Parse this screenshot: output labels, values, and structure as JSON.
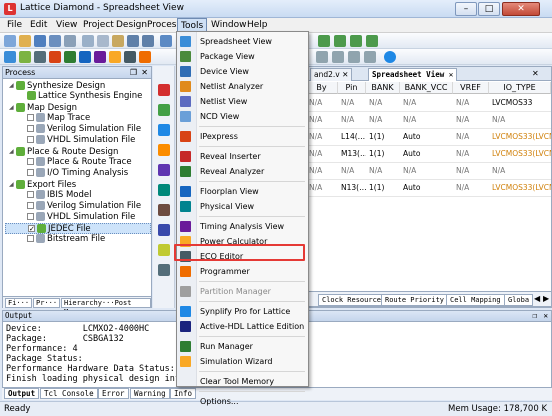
{
  "window": {
    "title": "Lattice Diamond - Spreadsheet View",
    "controls": [
      "–",
      "□",
      "✕"
    ]
  },
  "menubar": [
    "File",
    "Edit",
    "View",
    "Project",
    "Design",
    "Process",
    "Tools",
    "Window",
    "Help"
  ],
  "process_panel": {
    "title": "Process",
    "items": [
      {
        "label": "Synthesize Design",
        "level": 0,
        "kind": "group"
      },
      {
        "label": "Lattice Synthesis Engine",
        "level": 1,
        "kind": "step"
      },
      {
        "label": "Map Design",
        "level": 0,
        "kind": "group"
      },
      {
        "label": "Map Trace",
        "level": 1,
        "kind": "check"
      },
      {
        "label": "Verilog Simulation File",
        "level": 1,
        "kind": "check"
      },
      {
        "label": "VHDL Simulation File",
        "level": 1,
        "kind": "check"
      },
      {
        "label": "Place & Route Design",
        "level": 0,
        "kind": "group"
      },
      {
        "label": "Place & Route Trace",
        "level": 1,
        "kind": "check"
      },
      {
        "label": "I/O Timing Analysis",
        "level": 1,
        "kind": "check"
      },
      {
        "label": "Export Files",
        "level": 0,
        "kind": "group"
      },
      {
        "label": "IBIS Model",
        "level": 1,
        "kind": "check"
      },
      {
        "label": "Verilog Simulation File",
        "level": 1,
        "kind": "check"
      },
      {
        "label": "VHDL Simulation File",
        "level": 1,
        "kind": "check"
      },
      {
        "label": "JEDEC File",
        "level": 1,
        "kind": "checked",
        "selected": true
      },
      {
        "label": "Bitstream File",
        "level": 1,
        "kind": "check"
      }
    ],
    "bottom_tabs": [
      "Fi···",
      "Pr···",
      "Hierarchy···Post M···"
    ]
  },
  "tools_menu": [
    {
      "label": "Spreadsheet View",
      "icon_color": "#3a8dd8"
    },
    {
      "label": "Package View",
      "icon_color": "#4a8a3c"
    },
    {
      "label": "Device View",
      "icon_color": "#2f6db5"
    },
    {
      "label": "Netlist Analyzer",
      "icon_color": "#e08a1c"
    },
    {
      "label": "Netlist View",
      "icon_color": "#5c6bc0"
    },
    {
      "label": "NCD View",
      "icon_color": "#6a9fd8"
    },
    {
      "sep": true
    },
    {
      "label": "IPexpress",
      "icon_color": "#d84315"
    },
    {
      "sep": true
    },
    {
      "label": "Reveal Inserter",
      "icon_color": "#c62828"
    },
    {
      "label": "Reveal Analyzer",
      "icon_color": "#2e7d32"
    },
    {
      "sep": true
    },
    {
      "label": "Floorplan View",
      "icon_color": "#1565c0"
    },
    {
      "label": "Physical View",
      "icon_color": "#00838f"
    },
    {
      "sep": true
    },
    {
      "label": "Timing Analysis View",
      "icon_color": "#6a1b9a"
    },
    {
      "label": "Power Calculator",
      "icon_color": "#f9a825"
    },
    {
      "label": "ECO Editor",
      "icon_color": "#455a64"
    },
    {
      "label": "Programmer",
      "icon_color": "#ef6c00",
      "highlight": true
    },
    {
      "sep": true
    },
    {
      "label": "Partition Manager",
      "icon_color": "#9e9e9e",
      "disabled": true
    },
    {
      "sep": true
    },
    {
      "label": "Synplify Pro for Lattice",
      "icon_color": "#1e88e5"
    },
    {
      "label": "Active-HDL Lattice Edition",
      "icon_color": "#1a237e"
    },
    {
      "sep": true
    },
    {
      "label": "Run Manager",
      "icon_color": "#2e7d32"
    },
    {
      "label": "Simulation Wizard",
      "icon_color": "#f9a825"
    },
    {
      "sep": true
    },
    {
      "label": "Clear Tool Memory",
      "icon_color": ""
    },
    {
      "sep": true
    },
    {
      "label": "Options...",
      "icon_color": ""
    }
  ],
  "sheet": {
    "tabs": [
      "and2.v ✕",
      "Spreadsheet View ✕"
    ],
    "columns": [
      "By",
      "Pin",
      "BANK",
      "BANK_VCC",
      "VREF",
      "IO_TYPE"
    ],
    "rows": [
      [
        "N/A",
        "N/A",
        "N/A",
        "N/A",
        "N/A",
        "LVCMOS33"
      ],
      [
        "N/A",
        "N/A",
        "N/A",
        "N/A",
        "N/A",
        "N/A"
      ],
      [
        "N/A",
        "L14(…",
        "1(1)",
        "Auto",
        "N/A",
        "LVCMOS33(LVCM"
      ],
      [
        "N/A",
        "M13(…",
        "1(1)",
        "Auto",
        "N/A",
        "LVCMOS33(LVCM"
      ],
      [
        "N/A",
        "N/A",
        "N/A",
        "N/A",
        "N/A",
        "N/A"
      ],
      [
        "N/A",
        "N13(…",
        "1(1)",
        "Auto",
        "N/A",
        "LVCMOS33(LVCM"
      ]
    ],
    "bottom_tabs": [
      "Clock Resource",
      "Route Priority",
      "Cell Mapping",
      "Globa"
    ]
  },
  "output": {
    "title": "Output",
    "lines": [
      "Device:        LCMXO2-4000HC",
      "Package:       CSBGA132",
      "Performance: 4",
      "Package Status:",
      "Performance Hardware Data Status:",
      "Finish loading physical design infor"
    ],
    "tabs": [
      "Output",
      "Tcl Console",
      "Error",
      "Warning",
      "Info"
    ]
  },
  "status": {
    "left": "Ready",
    "memory": "Mem Usage: 178,700 K"
  }
}
